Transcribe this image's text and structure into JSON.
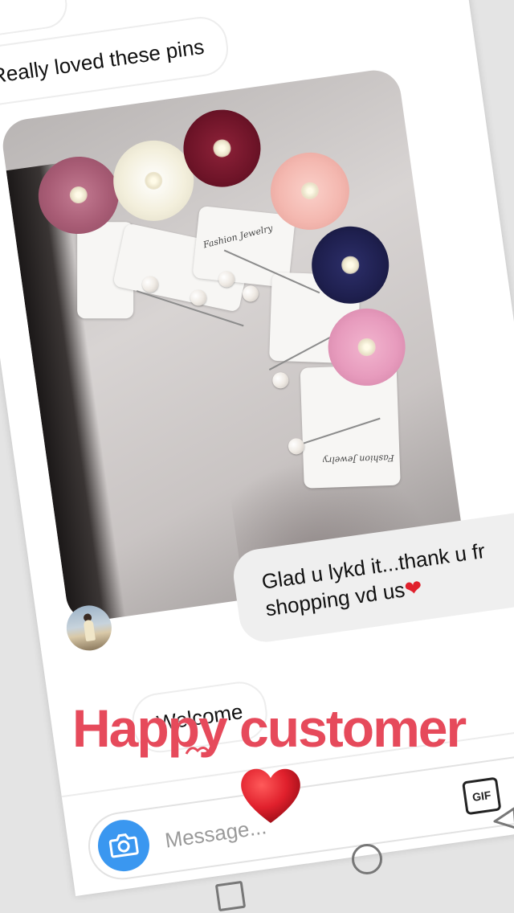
{
  "chat": {
    "received_message_1": "Really loved these pins",
    "sent_message": "Glad u lykd it...thank u fr shopping vd us",
    "sent_message_line1": "Glad u lykd it...thank u fr",
    "sent_message_line2": "shopping vd us",
    "received_message_2": "Welcome",
    "photo": {
      "card_label": "Fashion Jewelry",
      "flower_colors": [
        "#a85c75",
        "#f3efdc",
        "#6e1428",
        "#f4b8b0",
        "#1e1f4e",
        "#e79bbd"
      ]
    }
  },
  "composer": {
    "placeholder": "Message...",
    "visible_text": "Messa",
    "gif_label": "GIF",
    "camera_icon": "camera-icon",
    "gallery_icon": "gallery-icon"
  },
  "sticker": {
    "text": "Happy customer",
    "color": "#e64a5b",
    "heart_color": "#e0202c"
  },
  "accent_colors": {
    "camera_button": "#3a97f0",
    "bubble_mine": "#efefef"
  }
}
